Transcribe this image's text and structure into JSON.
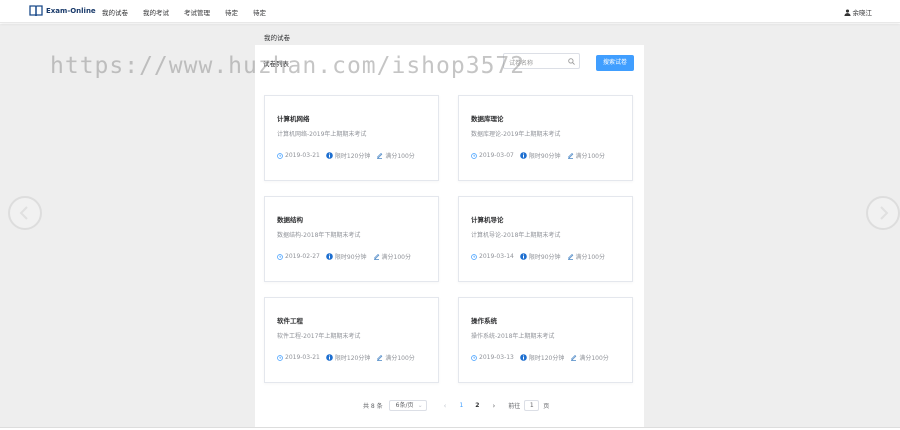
{
  "header": {
    "logo_text": "Exam-Online",
    "nav": [
      "我的试卷",
      "我的考试",
      "考试管理",
      "待定",
      "待定"
    ],
    "user_name": "余晓江"
  },
  "breadcrumb": "我的试卷",
  "panel": {
    "title": "试卷列表",
    "search_placeholder": "试卷名称",
    "search_button": "搜索试卷"
  },
  "cards": [
    {
      "title": "计算机网络",
      "desc": "计算机网络-2019年上期期末考试",
      "date": "2019-03-21",
      "time": "限时120分钟",
      "score": "满分100分"
    },
    {
      "title": "数据库理论",
      "desc": "数据库理论-2019年上期期末考试",
      "date": "2019-03-07",
      "time": "限时90分钟",
      "score": "满分100分"
    },
    {
      "title": "数据结构",
      "desc": "数据结构-2018年下期期末考试",
      "date": "2019-02-27",
      "time": "限时90分钟",
      "score": "满分100分"
    },
    {
      "title": "计算机导论",
      "desc": "计算机导论-2018年上期期末考试",
      "date": "2019-03-14",
      "time": "限时90分钟",
      "score": "满分100分"
    },
    {
      "title": "软件工程",
      "desc": "软件工程-2017年上期期末考试",
      "date": "2019-03-21",
      "time": "限时120分钟",
      "score": "满分100分"
    },
    {
      "title": "操作系统",
      "desc": "操作系统-2018年上期期末考试",
      "date": "2019-03-13",
      "time": "限时120分钟",
      "score": "满分100分"
    }
  ],
  "pagination": {
    "total": "共 8 条",
    "page_size": "6条/页",
    "pages": [
      "1",
      "2"
    ],
    "goto_label": "前往",
    "goto_value": "1",
    "page_unit": "页"
  },
  "watermark": "https://www.huzhan.com/ishop3572",
  "colors": {
    "accent": "#409eff",
    "background": "#eeeeee"
  }
}
